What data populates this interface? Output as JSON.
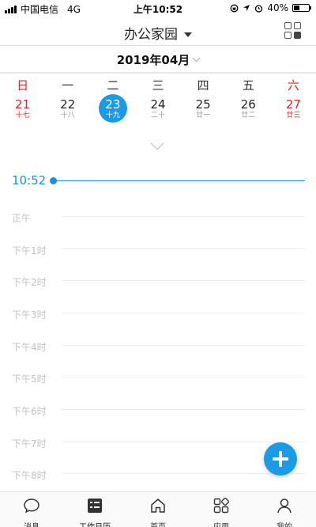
{
  "status_bar": {
    "carrier": "中国电信",
    "network": "4G",
    "time": "上午10:52",
    "battery": "40%",
    "battery_level": 0.4
  },
  "header": {
    "title": "办公家园",
    "grid_icon": "apps-grid-icon"
  },
  "calendar": {
    "month_label": "2019年04月",
    "weekdays": [
      "日",
      "一",
      "二",
      "三",
      "四",
      "五",
      "六"
    ],
    "dates": [
      {
        "day": "21",
        "lunar": "十七"
      },
      {
        "day": "22",
        "lunar": "十八"
      },
      {
        "day": "23",
        "lunar": "十九"
      },
      {
        "day": "24",
        "lunar": "二十"
      },
      {
        "day": "25",
        "lunar": "廿一"
      },
      {
        "day": "26",
        "lunar": "廿二"
      },
      {
        "day": "27",
        "lunar": "廿三"
      }
    ],
    "selected_day": "23",
    "accent_color": "#1a9be8",
    "weekend_color": "#e02020"
  },
  "timeline": {
    "current_time": "10:52",
    "slots": [
      "正午",
      "下午1时",
      "下午2时",
      "下午3时",
      "下午4时",
      "下午5时",
      "下午6时",
      "下午7时",
      "下午8时"
    ]
  },
  "fab": {
    "icon": "plus-icon"
  },
  "tabbar": {
    "tabs": [
      {
        "label": "消息",
        "icon": "message-icon"
      },
      {
        "label": "工作日历",
        "icon": "calendar-list-icon"
      },
      {
        "label": "首页",
        "icon": "home-icon"
      },
      {
        "label": "应用",
        "icon": "apps-icon"
      },
      {
        "label": "我的",
        "icon": "person-icon"
      }
    ],
    "active_index": 1
  }
}
